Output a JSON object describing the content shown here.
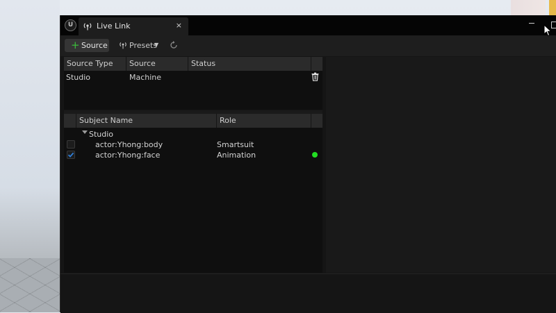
{
  "window": {
    "tab_title": "Live Link",
    "tab_close": "×",
    "logo_text": "U"
  },
  "toolbar": {
    "source_label": "Source",
    "source_icon": "plus-icon",
    "presets_label": "Presets",
    "refresh_icon": "refresh-icon"
  },
  "sources": {
    "columns": [
      "Source Type",
      "Source Machine",
      "Status"
    ],
    "rows": [
      {
        "source_type": "Studio",
        "source_machine": "",
        "status": ""
      }
    ]
  },
  "subjects": {
    "columns": [
      "Subject Name",
      "Role"
    ],
    "group": "Studio",
    "rows": [
      {
        "name": "actor:Yhong:body",
        "role": "Smartsuit",
        "checked": false,
        "status_color": ""
      },
      {
        "name": "actor:Yhong:face",
        "role": "Animation",
        "checked": true,
        "status_color": "#22dd22"
      }
    ]
  },
  "colors": {
    "accent_green": "#3bbd3b",
    "check_blue": "#2f7fd8",
    "status_green": "#22dd22"
  }
}
